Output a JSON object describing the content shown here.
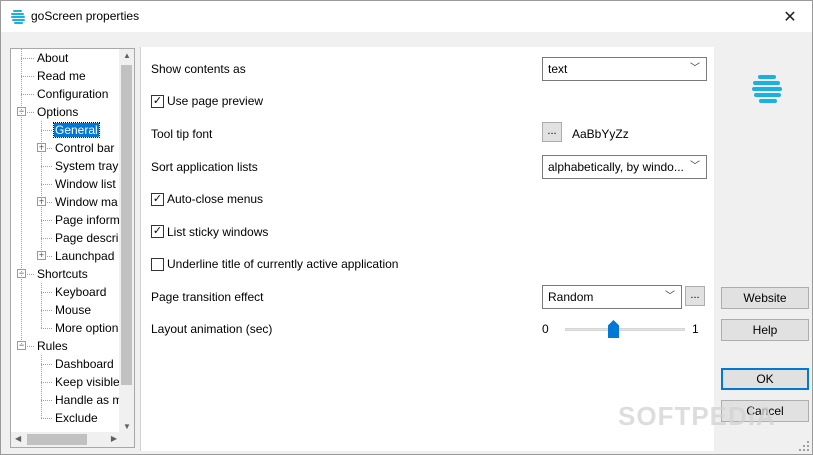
{
  "window": {
    "title": "goScreen properties",
    "icon": "goscreen-logo-icon",
    "close_glyph": "✕"
  },
  "tree": {
    "expand_glyph": "+",
    "collapse_glyph": "−",
    "nodes": [
      {
        "label": "About",
        "level": 0,
        "expander": "none"
      },
      {
        "label": "Read me",
        "level": 0,
        "expander": "none"
      },
      {
        "label": "Configuration",
        "level": 0,
        "expander": "none"
      },
      {
        "label": "Options",
        "level": 0,
        "expander": "minus"
      },
      {
        "label": "General",
        "level": 1,
        "expander": "none",
        "selected": true
      },
      {
        "label": "Control bar",
        "level": 1,
        "expander": "plus"
      },
      {
        "label": "System tray",
        "level": 1,
        "expander": "none"
      },
      {
        "label": "Window list",
        "level": 1,
        "expander": "none"
      },
      {
        "label": "Window ma",
        "level": 1,
        "expander": "plus"
      },
      {
        "label": "Page inform",
        "level": 1,
        "expander": "none"
      },
      {
        "label": "Page descrip",
        "level": 1,
        "expander": "none"
      },
      {
        "label": "Launchpad",
        "level": 1,
        "expander": "plus"
      },
      {
        "label": "Shortcuts",
        "level": 0,
        "expander": "minus"
      },
      {
        "label": "Keyboard",
        "level": 1,
        "expander": "none"
      },
      {
        "label": "Mouse",
        "level": 1,
        "expander": "none"
      },
      {
        "label": "More option",
        "level": 1,
        "expander": "none"
      },
      {
        "label": "Rules",
        "level": 0,
        "expander": "minus"
      },
      {
        "label": "Dashboard",
        "level": 1,
        "expander": "none"
      },
      {
        "label": "Keep visible",
        "level": 1,
        "expander": "none"
      },
      {
        "label": "Handle as m",
        "level": 1,
        "expander": "none"
      },
      {
        "label": "Exclude",
        "level": 1,
        "expander": "none"
      }
    ]
  },
  "settings": {
    "show_contents_label": "Show contents as",
    "show_contents_value": "text",
    "use_page_preview_label": "Use page preview",
    "use_page_preview_checked": true,
    "tooltip_font_label": "Tool tip font",
    "tooltip_font_button": "...",
    "tooltip_font_sample": "AaBbYyZz",
    "sort_lists_label": "Sort application lists",
    "sort_lists_value": "alphabetically, by windo...",
    "auto_close_label": "Auto-close menus",
    "auto_close_checked": true,
    "sticky_label": "List sticky windows",
    "sticky_checked": true,
    "underline_label": "Underline title of currently active application",
    "underline_checked": false,
    "transition_label": "Page transition effect",
    "transition_value": "Random",
    "transition_more": "...",
    "animation_label": "Layout animation (sec)",
    "animation_min": "0",
    "animation_max": "1",
    "animation_value": 0.4
  },
  "buttons": {
    "website": "Website",
    "help": "Help",
    "ok": "OK",
    "cancel": "Cancel"
  },
  "watermark": "SOFTPEDIA",
  "colors": {
    "accent": "#0078d7",
    "brand": "#1ab0e0"
  }
}
